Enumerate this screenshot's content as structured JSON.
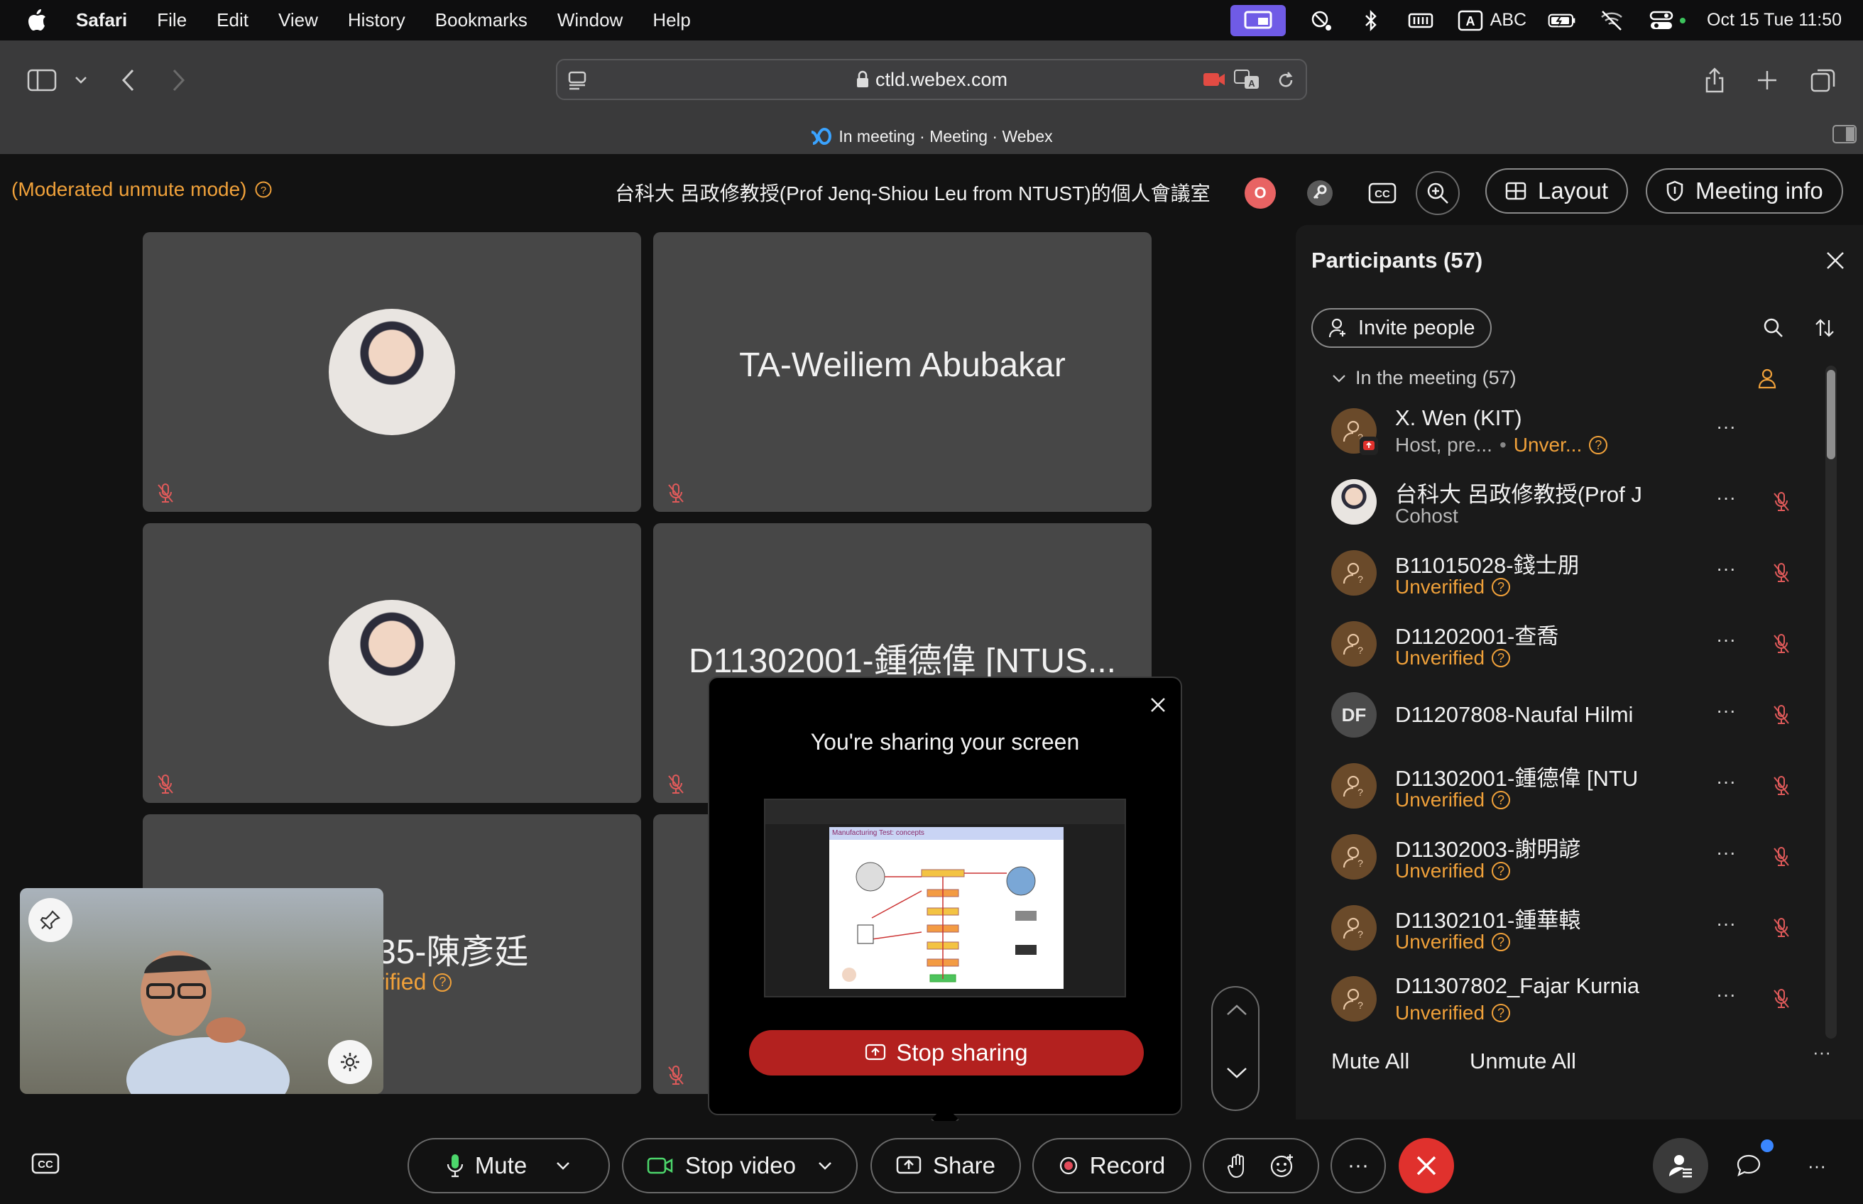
{
  "menubar": {
    "app": "Safari",
    "menus": [
      "File",
      "Edit",
      "View",
      "History",
      "Bookmarks",
      "Window",
      "Help"
    ],
    "input_source": "ABC",
    "datetime": "Oct 15 Tue  11:50"
  },
  "browser": {
    "url": "ctld.webex.com",
    "tab_title": "In meeting · Meeting · Webex"
  },
  "meeting": {
    "mode": "(Moderated unmute mode)",
    "room_title": "台科大 呂政修教授(Prof Jenq-Shiou Leu from NTUST)的個人會議室",
    "layout_label": "Layout",
    "meeting_info_label": "Meeting info",
    "record_indicator": "O"
  },
  "tiles": [
    {
      "name": ""
    },
    {
      "name": "TA-Weiliem Abubakar"
    },
    {
      "name": ""
    },
    {
      "name": "D11302001-鍾德偉 [NTUS..."
    },
    {
      "name": "35-陳彥廷",
      "status": "rified"
    },
    {
      "name": ""
    }
  ],
  "share_popup": {
    "title": "You're sharing your screen",
    "stop_label": "Stop sharing",
    "thumb_heading": "Manufacturing Test: concepts"
  },
  "participants": {
    "title": "Participants (57)",
    "invite_label": "Invite people",
    "section_label": "In the meeting (57)",
    "mute_all": "Mute All",
    "unmute_all": "Unmute All",
    "list": [
      {
        "name": "X. Wen (KIT)",
        "role": "Host, pre...",
        "status": "Unver...",
        "avatar": "icon"
      },
      {
        "name": "台科大 呂政修教授(Prof J",
        "role": "Cohost",
        "status": "",
        "avatar": "photo"
      },
      {
        "name": "B11015028-錢士朋",
        "role": "",
        "status": "Unverified",
        "avatar": "icon"
      },
      {
        "name": "D11202001-查喬",
        "role": "",
        "status": "Unverified",
        "avatar": "icon"
      },
      {
        "name": "D11207808-Naufal Hilmi",
        "role": "",
        "status": "",
        "avatar": "DF"
      },
      {
        "name": "D11302001-鍾德偉 [NTU",
        "role": "",
        "status": "Unverified",
        "avatar": "icon"
      },
      {
        "name": "D11302003-謝明諺",
        "role": "",
        "status": "Unverified",
        "avatar": "icon"
      },
      {
        "name": "D11302101-鍾華轅",
        "role": "",
        "status": "Unverified",
        "avatar": "icon"
      },
      {
        "name": "D11307802_Fajar Kurnia",
        "role": "",
        "status": "Unverified",
        "avatar": "icon"
      }
    ]
  },
  "controls": {
    "mute": "Mute",
    "stop_video": "Stop video",
    "share": "Share",
    "record": "Record",
    "more": "···"
  },
  "colors": {
    "warning": "#f0a13a",
    "danger": "#b3211f",
    "end_call": "#e0312d",
    "accent": "#6f5be6"
  }
}
